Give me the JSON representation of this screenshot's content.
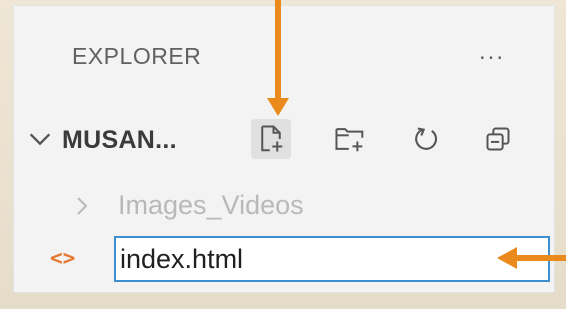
{
  "explorer": {
    "title": "EXPLORER",
    "more_actions": "...",
    "folder": {
      "name": "MUSAN...",
      "actions": [
        {
          "icon": "new-file-icon"
        },
        {
          "icon": "new-folder-icon"
        },
        {
          "icon": "refresh-icon"
        },
        {
          "icon": "collapse-all-icon"
        }
      ]
    },
    "items": [
      {
        "label": "Images_Videos",
        "type": "folder",
        "state": "collapsed"
      }
    ],
    "new_file_input": {
      "value": "index.html",
      "icon": "html-file-icon",
      "icon_text": "<>"
    }
  },
  "colors": {
    "accent_arrow": "#ea8a1d",
    "input_border": "#3c8fd0",
    "html_icon": "#e37933",
    "panel_bg": "#f3f3f3"
  }
}
